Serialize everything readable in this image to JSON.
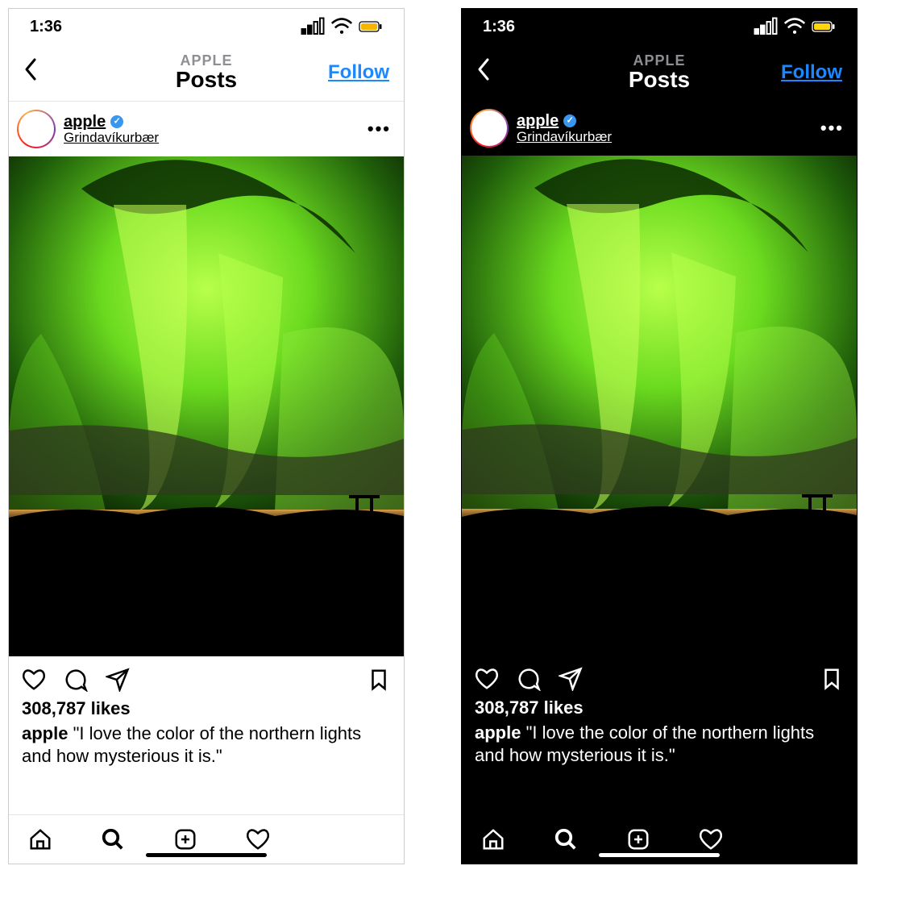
{
  "status": {
    "time": "1:36"
  },
  "nav": {
    "subtitle": "APPLE",
    "title": "Posts",
    "follow_label": "Follow"
  },
  "post": {
    "username": "apple",
    "location": "Grindavíkurbær",
    "likes_text": "308,787 likes",
    "caption_user": "apple",
    "caption_text": "\"I love the color of the northern lights and how mysterious it is.\""
  }
}
